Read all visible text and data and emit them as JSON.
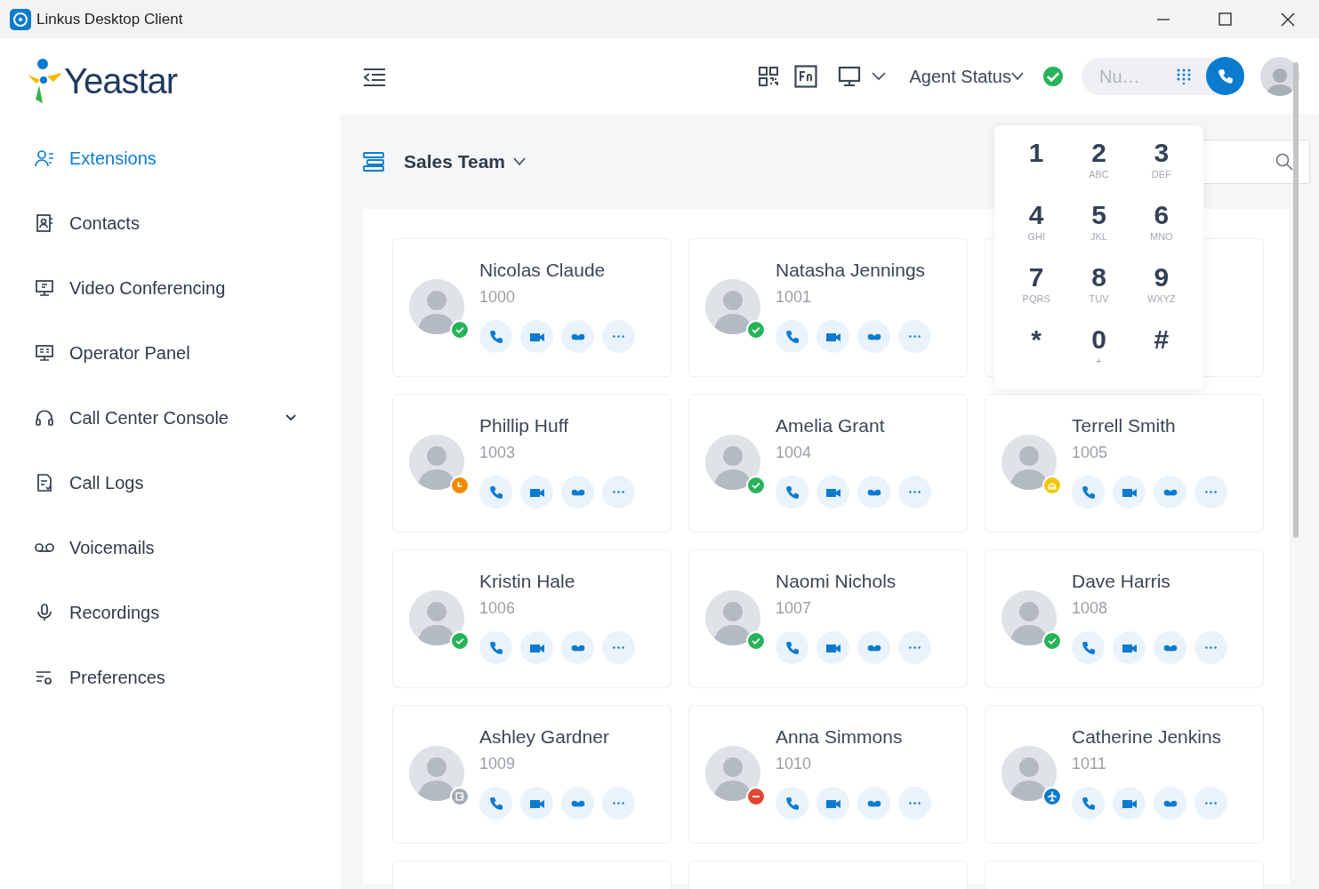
{
  "window": {
    "title": "Linkus Desktop Client"
  },
  "logo": {
    "text": "Yeastar"
  },
  "sidebar": {
    "items": [
      {
        "label": "Extensions",
        "kind": "extensions",
        "selected": true
      },
      {
        "label": "Contacts",
        "kind": "contacts",
        "selected": false
      },
      {
        "label": "Video Conferencing",
        "kind": "video",
        "selected": false
      },
      {
        "label": "Operator Panel",
        "kind": "operator",
        "selected": false
      },
      {
        "label": "Call Center Console",
        "kind": "callcenter",
        "selected": false,
        "expanded": false
      },
      {
        "label": "Call Logs",
        "kind": "logs",
        "selected": false
      },
      {
        "label": "Voicemails",
        "kind": "voicemail",
        "selected": false
      },
      {
        "label": "Recordings",
        "kind": "recordings",
        "selected": false
      },
      {
        "label": "Preferences",
        "kind": "preferences",
        "selected": false
      }
    ]
  },
  "header": {
    "agent_status": {
      "label": "Agent Status",
      "color": "#27b35a"
    },
    "number_field": {
      "placeholder": "Nu…"
    }
  },
  "group": {
    "title": "Sales Team"
  },
  "contacts": [
    {
      "kind": "contact",
      "name": "Nicolas Claude",
      "ext": "1000",
      "color": "#27b35a"
    },
    {
      "kind": "contact",
      "name": "Natasha Jennings",
      "ext": "1001",
      "color": "#27b35a"
    },
    {
      "kind": "covered"
    },
    {
      "kind": "contact",
      "name": "Phillip Huff",
      "ext": "1003",
      "color": "#f18a00"
    },
    {
      "kind": "contact",
      "name": "Amelia Grant",
      "ext": "1004",
      "color": "#27b35a"
    },
    {
      "kind": "contact",
      "name": "Terrell Smith",
      "ext": "1005",
      "color": "#f7c600"
    },
    {
      "kind": "contact",
      "name": "Kristin Hale",
      "ext": "1006",
      "color": "#27b35a"
    },
    {
      "kind": "contact",
      "name": "Naomi Nichols",
      "ext": "1007",
      "color": "#27b35a"
    },
    {
      "kind": "contact",
      "name": "Dave Harris",
      "ext": "1008",
      "color": "#27b35a"
    },
    {
      "kind": "contact",
      "name": "Ashley Gardner",
      "ext": "1009",
      "color": "#a4a9b2"
    },
    {
      "kind": "contact",
      "name": "Anna Simmons",
      "ext": "1010",
      "color": "#e5432d"
    },
    {
      "kind": "contact",
      "name": "Catherine Jenkins",
      "ext": "1011",
      "color": "#0b7bd0"
    }
  ],
  "dialpad": {
    "keys": [
      {
        "digit": "1"
      },
      {
        "digit": "2",
        "letters": "ABC"
      },
      {
        "digit": "3",
        "letters": "DEF"
      },
      {
        "digit": "4",
        "letters": "GHI"
      },
      {
        "digit": "5",
        "letters": "JKL"
      },
      {
        "digit": "6",
        "letters": "MNO"
      },
      {
        "digit": "7",
        "letters": "PQRS"
      },
      {
        "digit": "8",
        "letters": "TUV"
      },
      {
        "digit": "9",
        "letters": "WXYZ"
      },
      {
        "digit": "*"
      },
      {
        "digit": "0",
        "letters": "+"
      },
      {
        "digit": "#"
      }
    ]
  }
}
